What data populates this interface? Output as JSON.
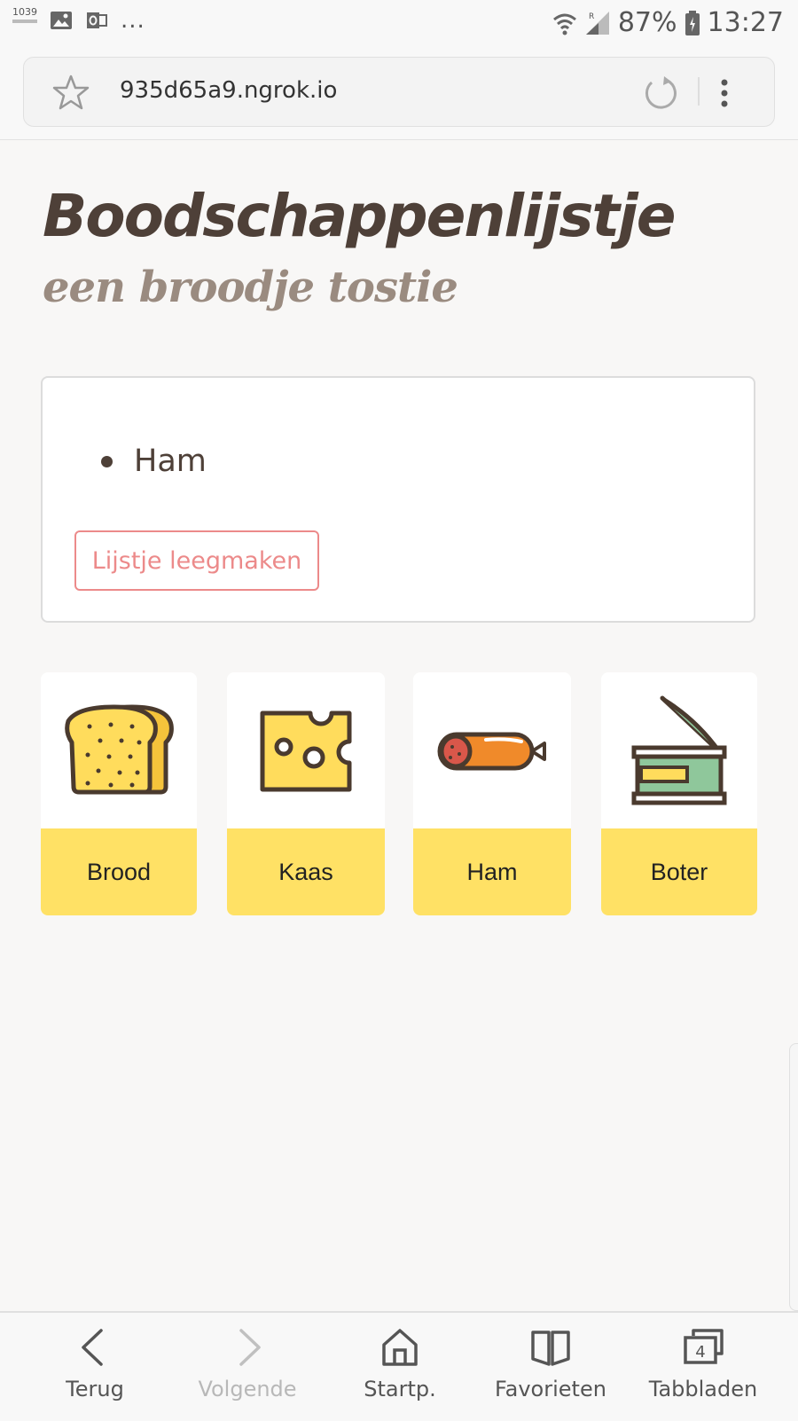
{
  "status_bar": {
    "counter": "1039",
    "overflow": "...",
    "battery_percent": "87%",
    "time": "13:27",
    "icons": [
      "gallery-icon",
      "outlook-icon",
      "wifi-icon",
      "signal-icon",
      "battery-icon"
    ]
  },
  "browser": {
    "url": "935d65a9.ngrok.io",
    "icons": [
      "star-icon",
      "reload-icon",
      "menu-icon"
    ]
  },
  "page": {
    "title": "Boodschappenlijstje",
    "subtitle": "een broodje tostie"
  },
  "shopping_list": {
    "items": [
      "Ham"
    ],
    "clear_button": "Lijstje leegmaken"
  },
  "products": [
    {
      "label": "Brood",
      "icon": "bread-icon"
    },
    {
      "label": "Kaas",
      "icon": "cheese-icon"
    },
    {
      "label": "Ham",
      "icon": "sausage-icon"
    },
    {
      "label": "Boter",
      "icon": "butter-tin-icon"
    }
  ],
  "colors": {
    "title": "#4e4038",
    "subtitle": "#9a8b80",
    "clear_button": "#ec8a8a",
    "product_label_bg": "#ffe165",
    "page_bg": "#f8f7f6"
  },
  "bottom_nav": {
    "back": "Terug",
    "forward": "Volgende",
    "home": "Startp.",
    "bookmarks": "Favorieten",
    "tabs": "Tabbladen",
    "tab_count": "4"
  }
}
